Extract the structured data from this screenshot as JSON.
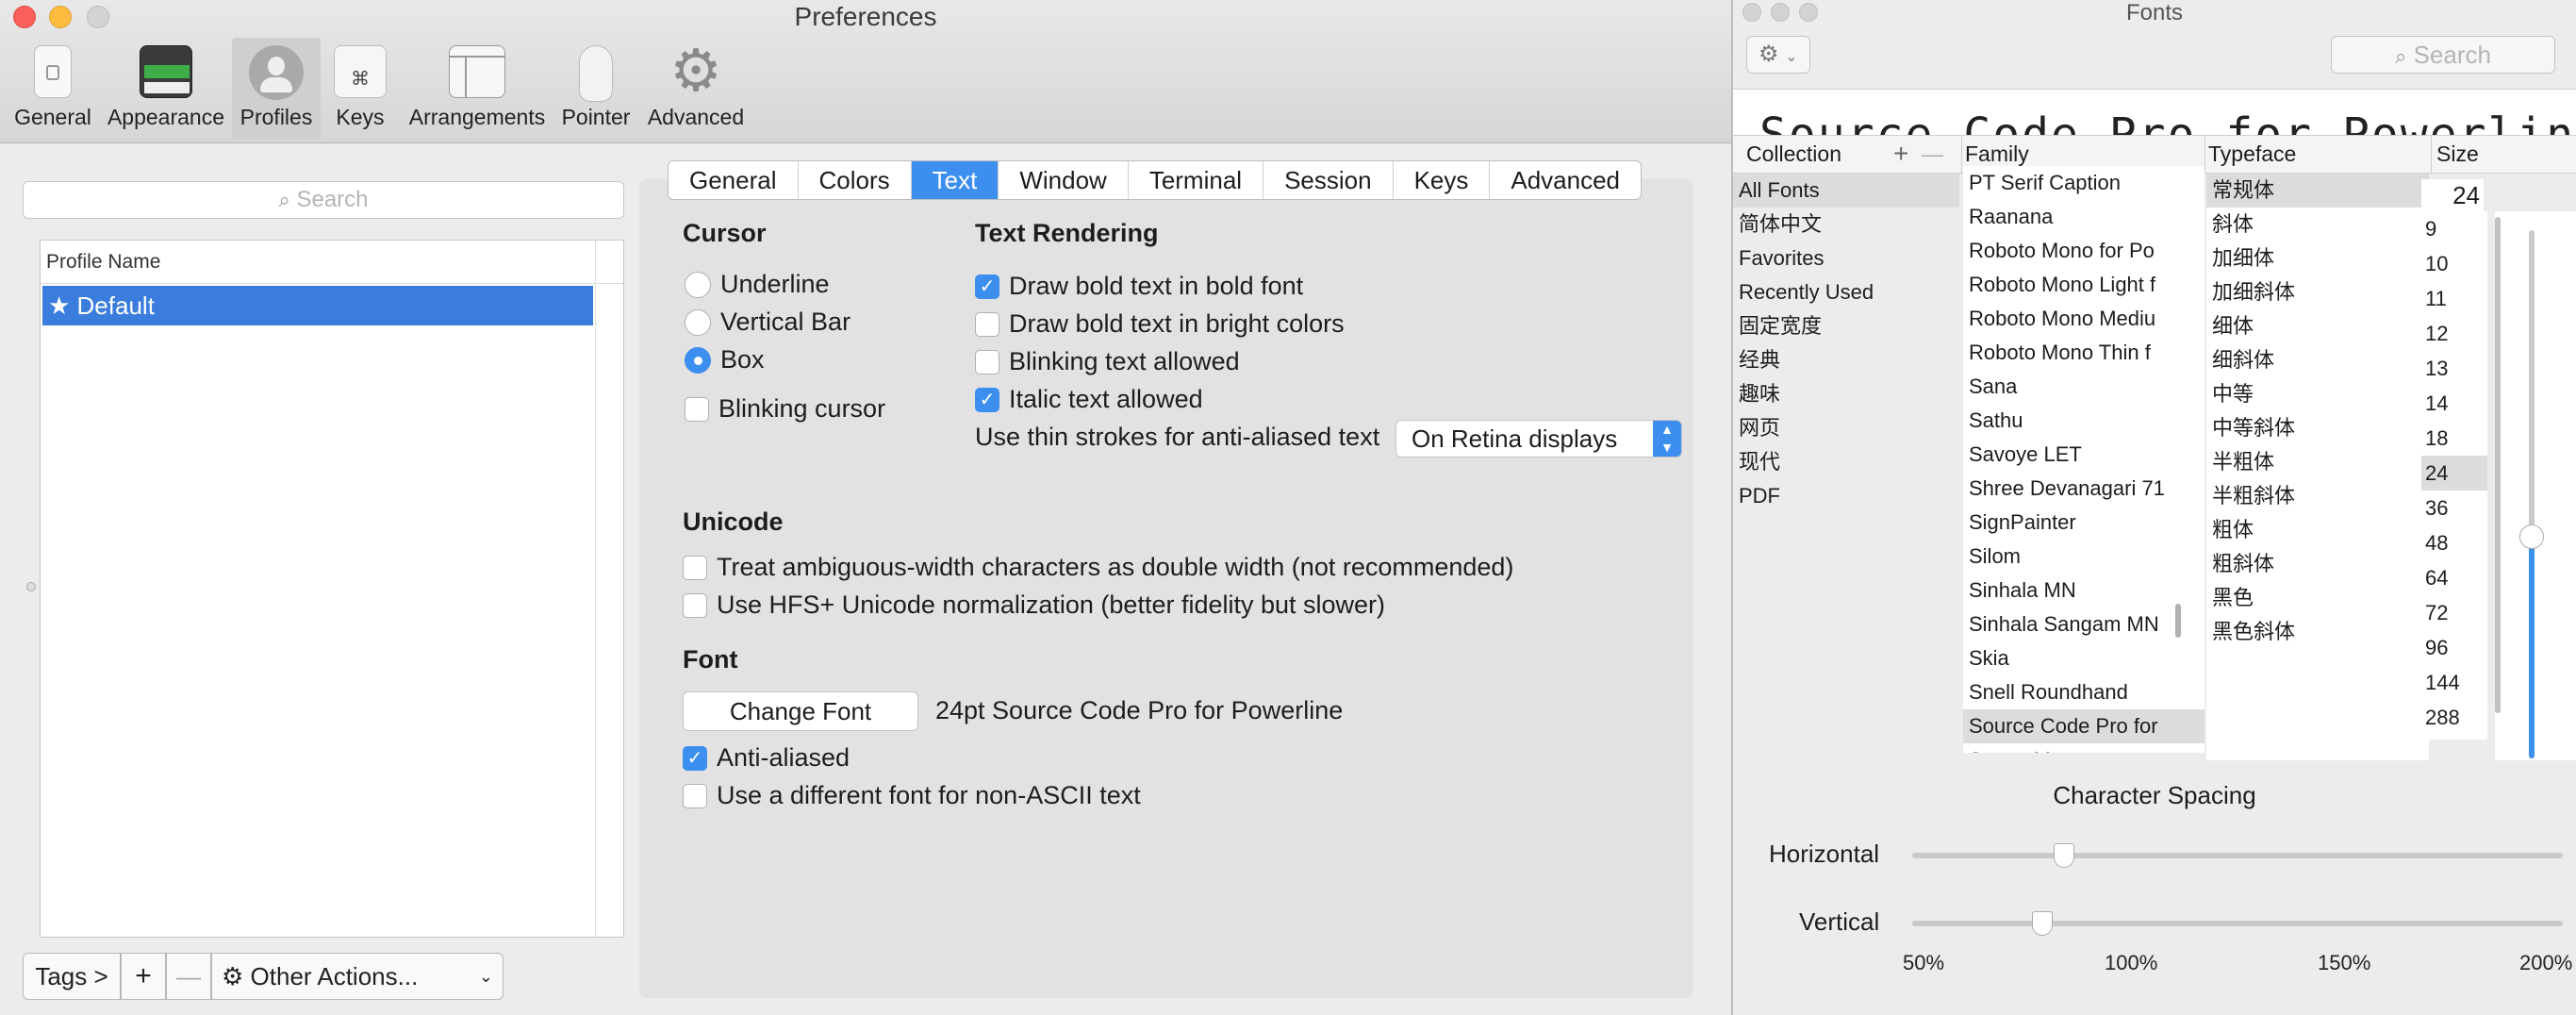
{
  "prefs": {
    "title": "Preferences",
    "toolbar": [
      {
        "label": "General",
        "icon": "switch-icon"
      },
      {
        "label": "Appearance",
        "icon": "window-icon"
      },
      {
        "label": "Profiles",
        "icon": "person-icon"
      },
      {
        "label": "Keys",
        "icon": "command-key-icon"
      },
      {
        "label": "Arrangements",
        "icon": "arrangements-icon"
      },
      {
        "label": "Pointer",
        "icon": "mouse-icon"
      },
      {
        "label": "Advanced",
        "icon": "gear-icon"
      }
    ],
    "search_placeholder": "Search",
    "profile_list": {
      "header": "Profile Name",
      "rows": [
        "★ Default"
      ]
    },
    "bottom": {
      "tags": "Tags >",
      "add": "+",
      "remove": "—",
      "other_actions": "Other Actions..."
    },
    "tabs": [
      "General",
      "Colors",
      "Text",
      "Window",
      "Terminal",
      "Session",
      "Keys",
      "Advanced"
    ],
    "selected_tab": "Text",
    "cursor": {
      "heading": "Cursor",
      "underline": "Underline",
      "vertical_bar": "Vertical Bar",
      "box": "Box",
      "blinking": "Blinking cursor"
    },
    "text_rendering": {
      "heading": "Text Rendering",
      "bold_font": "Draw bold text in bold font",
      "bright_colors": "Draw bold text in bright colors",
      "blinking_text": "Blinking text allowed",
      "italic": "Italic text allowed",
      "thin_strokes": "Use thin strokes for anti-aliased text",
      "thin_strokes_value": "On Retina displays"
    },
    "unicode": {
      "heading": "Unicode",
      "ambiguous": "Treat ambiguous-width characters as double width (not recommended)",
      "hfs": "Use HFS+ Unicode normalization (better fidelity but slower)"
    },
    "font": {
      "heading": "Font",
      "change_font": "Change Font",
      "current": "24pt Source Code Pro for Powerline",
      "anti_aliased": "Anti-aliased",
      "non_ascii": "Use a different font for non-ASCII text"
    }
  },
  "fonts_panel": {
    "title": "Fonts",
    "search_placeholder": "Search",
    "preview": "Source Code Pro for Powerline",
    "headers": {
      "collection": "Collection",
      "family": "Family",
      "typeface": "Typeface",
      "size": "Size",
      "add": "+",
      "remove": "—"
    },
    "collections": [
      "All Fonts",
      "简体中文",
      "Favorites",
      "Recently Used",
      "固定宽度",
      "经典",
      "趣味",
      "网页",
      "现代",
      "PDF"
    ],
    "families": [
      "PT Serif Caption",
      "Raanana",
      "Roboto Mono for Po",
      "Roboto Mono Light f",
      "Roboto Mono Mediu",
      "Roboto Mono Thin f",
      "Sana",
      "Sathu",
      "Savoye LET",
      "Shree Devanagari 71",
      "SignPainter",
      "Silom",
      "Sinhala MN",
      "Sinhala Sangam MN",
      "Skia",
      "Snell Roundhand",
      "Source Code Pro for",
      "Space Mono"
    ],
    "typefaces": [
      "常规体",
      "斜体",
      "加细体",
      "加细斜体",
      "细体",
      "细斜体",
      "中等",
      "中等斜体",
      "半粗体",
      "半粗斜体",
      "粗体",
      "粗斜体",
      "黑色",
      "黑色斜体"
    ],
    "size_value": "24",
    "sizes": [
      "9",
      "10",
      "11",
      "12",
      "13",
      "14",
      "18",
      "24",
      "36",
      "48",
      "64",
      "72",
      "96",
      "144",
      "288"
    ],
    "size_slider_level": 0.42,
    "spacing": {
      "heading": "Character Spacing",
      "horizontal": "Horizontal",
      "vertical": "Vertical",
      "ticks": [
        "50%",
        "100%",
        "150%",
        "200%"
      ],
      "horizontal_value": 0.85,
      "vertical_value": 0.8
    }
  },
  "colors": {
    "accent": "#3d8fef",
    "selection": "#3b7ddd",
    "close": "#fc605b",
    "minimize": "#fdbc40"
  }
}
